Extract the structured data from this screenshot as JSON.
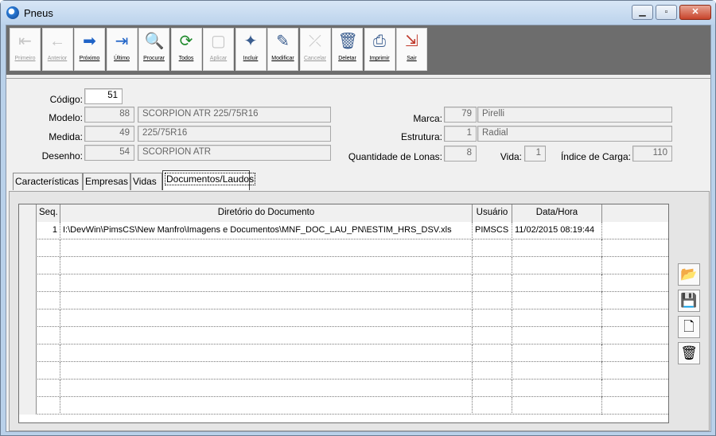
{
  "window": {
    "title": "Pneus",
    "buttons": {
      "minimize": "▁",
      "maximize": "▫",
      "close": "✕"
    }
  },
  "toolbar": [
    {
      "key": "primeiro",
      "label": "Primeiro",
      "icon": "first-record-icon",
      "glyph": "⇤",
      "enabled": false
    },
    {
      "key": "anterior",
      "label": "Anterior",
      "icon": "previous-record-icon",
      "glyph": "←",
      "enabled": false
    },
    {
      "key": "proximo",
      "label": "Próximo",
      "icon": "next-record-icon",
      "glyph": "➡",
      "enabled": true
    },
    {
      "key": "ultimo",
      "label": "Último",
      "icon": "last-record-icon",
      "glyph": "⇥",
      "enabled": true
    },
    {
      "key": "procurar",
      "label": "Procurar",
      "icon": "search-icon",
      "glyph": "🔍",
      "enabled": true
    },
    {
      "key": "todos",
      "label": "Todos",
      "icon": "refresh-all-icon",
      "glyph": "⟳",
      "enabled": true
    },
    {
      "key": "aplicar",
      "label": "Aplicar",
      "icon": "apply-icon",
      "glyph": "▢",
      "enabled": false
    },
    {
      "key": "incluir",
      "label": "Incluir",
      "icon": "new-record-icon",
      "glyph": "✦",
      "enabled": true
    },
    {
      "key": "modificar",
      "label": "Modificar",
      "icon": "edit-eraser-icon",
      "glyph": "✎",
      "enabled": true
    },
    {
      "key": "cancelar",
      "label": "Cancelar",
      "icon": "cancel-icon",
      "glyph": "⤫",
      "enabled": false
    },
    {
      "key": "deletar",
      "label": "Deletar",
      "icon": "trash-icon",
      "glyph": "🗑",
      "enabled": true
    },
    {
      "key": "imprimir",
      "label": "Imprimir",
      "icon": "printer-icon",
      "glyph": "⎙",
      "enabled": true
    },
    {
      "key": "sair",
      "label": "Sair",
      "icon": "exit-door-icon",
      "glyph": "⇲",
      "enabled": true
    }
  ],
  "form": {
    "codigo": {
      "label": "Código:",
      "value": "51"
    },
    "modelo": {
      "label": "Modelo:",
      "code": "88",
      "desc": "SCORPION ATR 225/75R16"
    },
    "medida": {
      "label": "Medida:",
      "code": "49",
      "desc": "225/75R16"
    },
    "desenho": {
      "label": "Desenho:",
      "code": "54",
      "desc": "SCORPION ATR"
    },
    "marca": {
      "label": "Marca:",
      "code": "79",
      "desc": "Pirelli"
    },
    "estrutura": {
      "label": "Estrutura:",
      "code": "1",
      "desc": "Radial"
    },
    "lonas": {
      "label": "Quantidade de Lonas:",
      "value": "8"
    },
    "vida": {
      "label": "Vida:",
      "value": "1"
    },
    "carga": {
      "label": "Índice de Carga:",
      "value": "110"
    }
  },
  "tabs": [
    "Características",
    "Empresas",
    "Vidas",
    "Documentos/Laudos"
  ],
  "active_tab": 3,
  "grid": {
    "columns": [
      "Seq.",
      "Diretório do Documento",
      "Usuário",
      "Data/Hora"
    ],
    "rows": [
      [
        "1",
        "I:\\DevWin\\PimsCS\\New Manfro\\Imagens e Documentos\\MNF_DOC_LAU_PN\\ESTIM_HRS_DSV.xls",
        "PIMSCS",
        "11/02/2015 08:19:44"
      ]
    ],
    "empty_rows": 10
  },
  "side_buttons": [
    {
      "name": "open-folder-button",
      "icon": "folder-icon",
      "glyph": "📂"
    },
    {
      "name": "save-button",
      "icon": "floppy-disk-icon",
      "glyph": "💾"
    },
    {
      "name": "new-document-button",
      "icon": "new-document-icon",
      "glyph": "🗋"
    },
    {
      "name": "delete-document-button",
      "icon": "trash-icon",
      "glyph": "🗑"
    }
  ]
}
